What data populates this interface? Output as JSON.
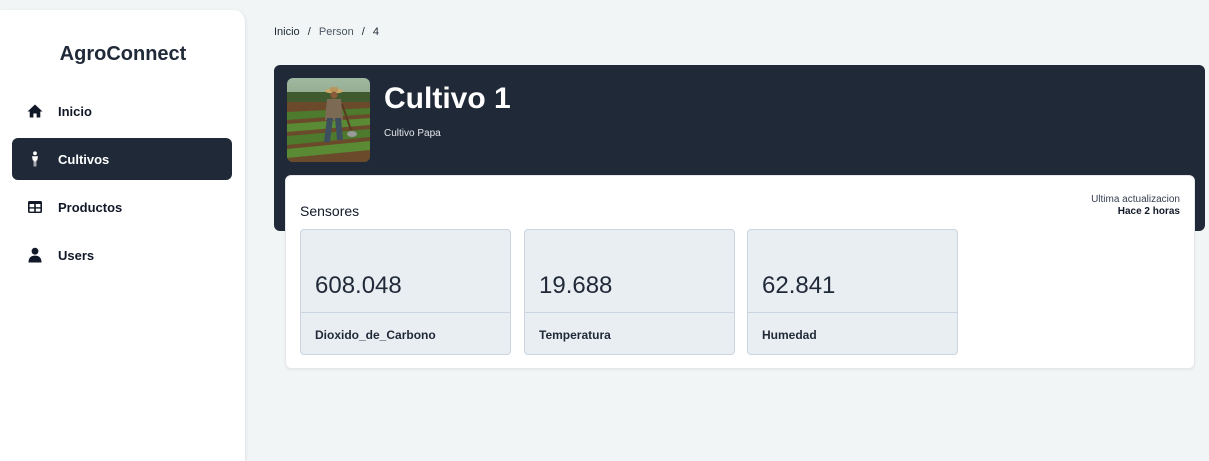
{
  "app": {
    "brand": "AgroConnect"
  },
  "sidebar": {
    "items": [
      {
        "label": "Inicio",
        "icon": "home-icon",
        "active": false
      },
      {
        "label": "Cultivos",
        "icon": "person-icon",
        "active": true
      },
      {
        "label": "Productos",
        "icon": "table-icon",
        "active": false
      },
      {
        "label": "Users",
        "icon": "user-icon",
        "active": false
      }
    ]
  },
  "breadcrumb": {
    "items": [
      "Inicio",
      "Person",
      "4"
    ],
    "separator": "/"
  },
  "hero": {
    "title": "Cultivo 1",
    "subtitle": "Cultivo Papa",
    "image": "farmer-field-photo"
  },
  "sensors": {
    "title": "Sensores",
    "last_update_label": "Ultima actualizacion",
    "last_update_value": "Hace 2 horas",
    "items": [
      {
        "value": "608.048",
        "label": "Dioxido_de_Carbono"
      },
      {
        "value": "19.688",
        "label": "Temperatura"
      },
      {
        "value": "62.841",
        "label": "Humedad"
      }
    ]
  },
  "colors": {
    "dark": "#1f2937",
    "background": "#f1f5f5",
    "sensor_bg": "#e9eef2"
  }
}
